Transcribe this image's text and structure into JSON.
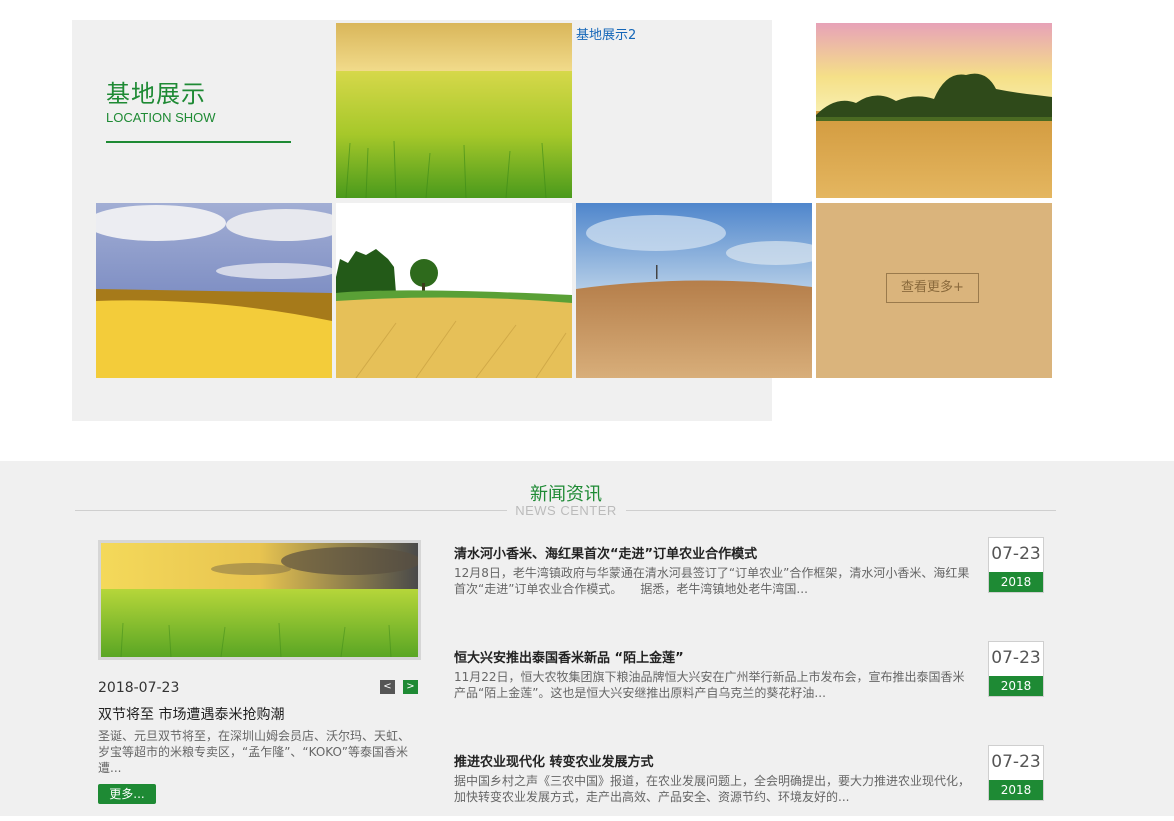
{
  "location": {
    "title": "基地展示",
    "subtitle": "LOCATION SHOW",
    "image_link_text": "基地展示2",
    "more_button": "查看更多+",
    "colors": {
      "accent": "#1e8a34",
      "more_tile": "#dab47c"
    }
  },
  "news": {
    "title": "新闻资讯",
    "subtitle": "NEWS CENTER",
    "featured": {
      "date": "2018-07-23",
      "title": "双节将至 市场遭遇泰米抢购潮",
      "text": "圣诞、元旦双节将至，在深圳山姆会员店、沃尔玛、天虹、岁宝等超市的米粮专卖区，“孟乍隆”、“KOKO”等泰国香米遭...",
      "more_label": "更多...",
      "prev_icon": "<",
      "next_icon": ">"
    },
    "items": [
      {
        "title": "清水河小香米、海红果首次“走进”订单农业合作模式",
        "text": "12月8日，老牛湾镇政府与华蒙通在清水河县签订了“订单农业”合作框架，清水河小香米、海红果首次“走进”订单农业合作模式。　　据悉，老牛湾镇地处老牛湾国...",
        "day": "07-23",
        "year": "2018"
      },
      {
        "title": "恒大兴安推出泰国香米新品 “陌上金莲”",
        "text": "11月22日，恒大农牧集团旗下粮油品牌恒大兴安在广州举行新品上市发布会，宣布推出泰国香米产品“陌上金莲”。这也是恒大兴安继推出原料产自乌克兰的葵花籽油...",
        "day": "07-23",
        "year": "2018"
      },
      {
        "title": "推进农业现代化 转变农业发展方式",
        "text": "据中国乡村之声《三农中国》报道，在农业发展问题上，全会明确提出，要大力推进农业现代化，加快转变农业发展方式，走产出高效、产品安全、资源节约、环境友好的...",
        "day": "07-23",
        "year": "2018"
      }
    ]
  }
}
